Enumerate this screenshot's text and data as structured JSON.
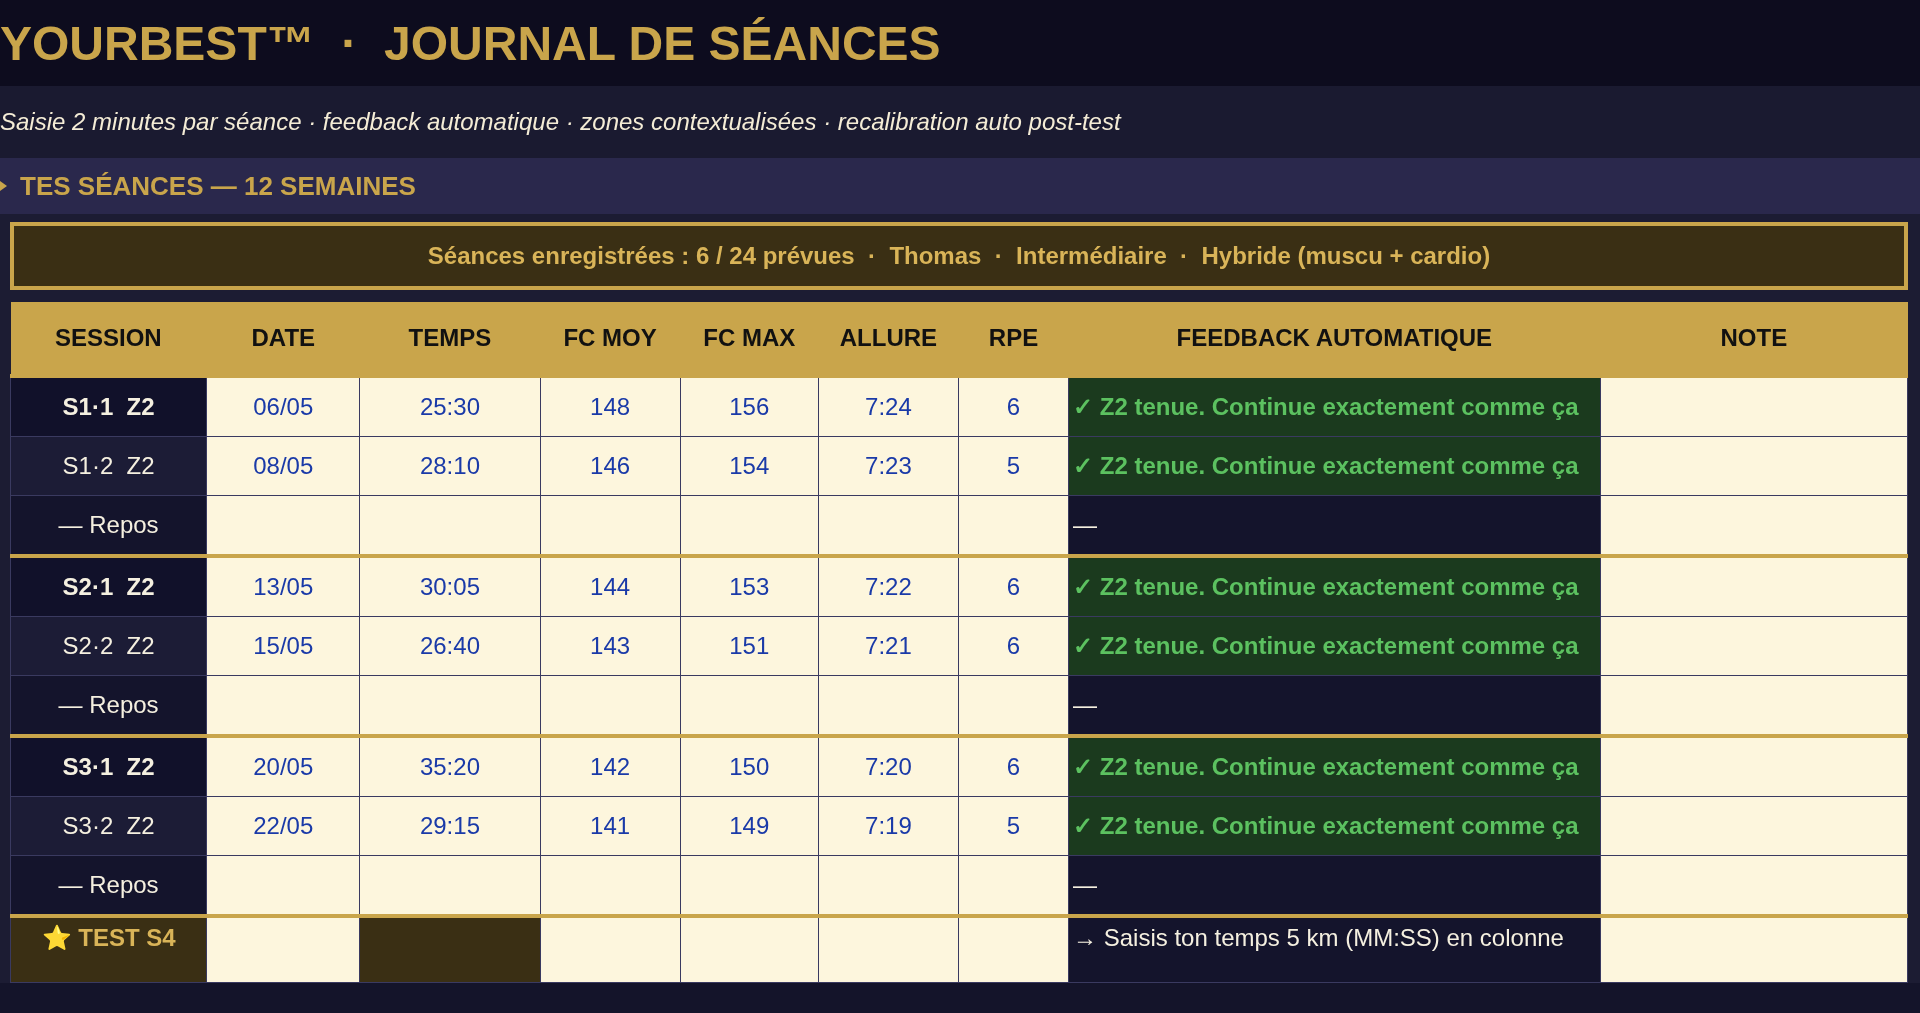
{
  "header": {
    "title": "YOURBEST™  ·  JOURNAL DE SÉANCES",
    "subtitle": "Saisie 2 minutes par séance · feedback automatique · zones contextualisées · recalibration auto post-test"
  },
  "section": {
    "title": "TES SÉANCES — 12 SEMAINES"
  },
  "summary": "Séances enregistrées : 6 / 24 prévues  ·  Thomas  ·  Intermédiaire  ·  Hybride (muscu + cardio)",
  "table": {
    "columns": [
      "SESSION",
      "DATE",
      "TEMPS",
      "FC MOY",
      "FC MAX",
      "ALLURE",
      "RPE",
      "FEEDBACK AUTOMATIQUE",
      "NOTE"
    ],
    "rows": [
      {
        "kind": "session",
        "week_start": true,
        "session": "S1·1  Z2",
        "date": "06/05",
        "temps": "25:30",
        "fc_moy": "148",
        "fc_max": "156",
        "allure": "7:24",
        "rpe": "6",
        "feedback": "✓ Z2 tenue. Continue exactement comme ça"
      },
      {
        "kind": "session",
        "week_start": false,
        "session": "S1·2  Z2",
        "date": "08/05",
        "temps": "28:10",
        "fc_moy": "146",
        "fc_max": "154",
        "allure": "7:23",
        "rpe": "5",
        "feedback": "✓ Z2 tenue. Continue exactement comme ça"
      },
      {
        "kind": "rest",
        "week_start": false,
        "session": "— Repos",
        "feedback": "—"
      },
      {
        "kind": "session",
        "week_start": true,
        "session": "S2·1  Z2",
        "date": "13/05",
        "temps": "30:05",
        "fc_moy": "144",
        "fc_max": "153",
        "allure": "7:22",
        "rpe": "6",
        "feedback": "✓ Z2 tenue. Continue exactement comme ça"
      },
      {
        "kind": "session",
        "week_start": false,
        "session": "S2·2  Z2",
        "date": "15/05",
        "temps": "26:40",
        "fc_moy": "143",
        "fc_max": "151",
        "allure": "7:21",
        "rpe": "6",
        "feedback": "✓ Z2 tenue. Continue exactement comme ça"
      },
      {
        "kind": "rest",
        "week_start": false,
        "session": "— Repos",
        "feedback": "—"
      },
      {
        "kind": "session",
        "week_start": true,
        "session": "S3·1  Z2",
        "date": "20/05",
        "temps": "35:20",
        "fc_moy": "142",
        "fc_max": "150",
        "allure": "7:20",
        "rpe": "6",
        "feedback": "✓ Z2 tenue. Continue exactement comme ça"
      },
      {
        "kind": "session",
        "week_start": false,
        "session": "S3·2  Z2",
        "date": "22/05",
        "temps": "29:15",
        "fc_moy": "141",
        "fc_max": "149",
        "allure": "7:19",
        "rpe": "5",
        "feedback": "✓ Z2 tenue. Continue exactement comme ça"
      },
      {
        "kind": "rest",
        "week_start": false,
        "session": "— Repos",
        "feedback": "—"
      },
      {
        "kind": "test",
        "week_start": true,
        "session": "⭐ TEST S4",
        "feedback": "→ Saisis ton temps 5 km (MM:SS) en colonne"
      }
    ]
  }
}
